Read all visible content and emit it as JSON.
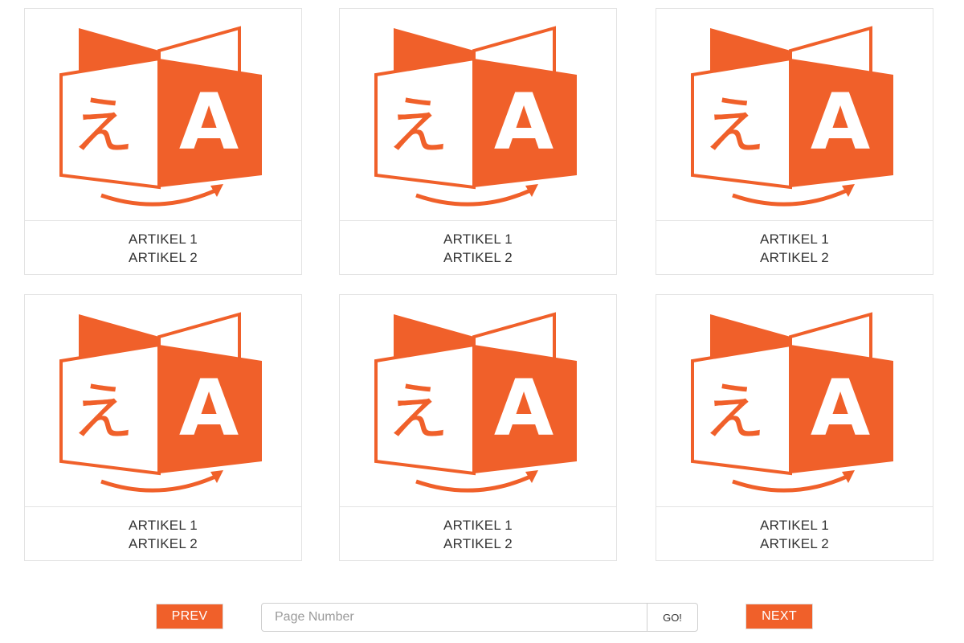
{
  "cards": [
    {
      "line1": "ARTIKEL 1",
      "line2": "ARTIKEL 2",
      "icon": "translate-icon"
    },
    {
      "line1": "ARTIKEL 1",
      "line2": "ARTIKEL 2",
      "icon": "translate-icon"
    },
    {
      "line1": "ARTIKEL 1",
      "line2": "ARTIKEL 2",
      "icon": "translate-icon"
    },
    {
      "line1": "ARTIKEL 1",
      "line2": "ARTIKEL 2",
      "icon": "translate-icon"
    },
    {
      "line1": "ARTIKEL 1",
      "line2": "ARTIKEL 2",
      "icon": "translate-icon"
    },
    {
      "line1": "ARTIKEL 1",
      "line2": "ARTIKEL 2",
      "icon": "translate-icon"
    }
  ],
  "pagination": {
    "prev_label": "PREV",
    "next_label": "NEXT",
    "go_label": "GO!",
    "page_input_placeholder": "Page Number",
    "page_input_value": ""
  },
  "colors": {
    "accent": "#f0602a",
    "border": "#e3e3e3",
    "text": "#333333"
  }
}
